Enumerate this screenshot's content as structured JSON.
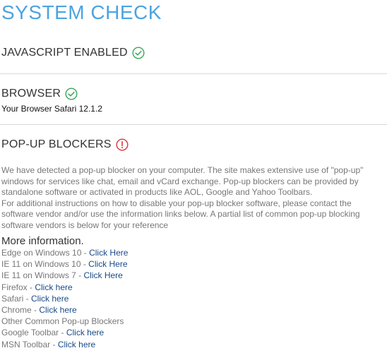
{
  "page": {
    "title": "SYSTEM CHECK"
  },
  "sections": {
    "javascript": {
      "label": "JAVASCRIPT ENABLED",
      "status": "ok"
    },
    "browser": {
      "label": "BROWSER",
      "status": "ok",
      "detail": "Your Browser Safari 12.1.2"
    },
    "popup": {
      "label": "POP-UP BLOCKERS",
      "status": "warning",
      "paragraph1": "We have detected a pop-up blocker on your computer. The site makes extensive use of \"pop-up\" windows for services like chat, email and vCard exchange. Pop-up blockers can be provided by standalone software or activated in products like AOL, Google and Yahoo Toolbars.",
      "paragraph2": "For additional instructions on how to disable your pop-up blocker software, please contact the software vendor and/or use the information links below. A partial list of common pop-up blocking software vendors is below for your reference"
    }
  },
  "more_info": {
    "heading": "More information.",
    "items": [
      {
        "label": "Edge on Windows 10 - ",
        "link": "Click Here"
      },
      {
        "label": "IE 11 on Windows 10 - ",
        "link": "Click Here"
      },
      {
        "label": "IE 11 on Windows 7 - ",
        "link": "Click Here"
      },
      {
        "label": "Firefox - ",
        "link": "Click here"
      },
      {
        "label": "Safari - ",
        "link": "Click here"
      },
      {
        "label": "Chrome - ",
        "link": "Click here"
      },
      {
        "label": "Other Common Pop-up Blockers",
        "link": ""
      },
      {
        "label": "Google Toolbar - ",
        "link": "Click here"
      },
      {
        "label": "MSN Toolbar - ",
        "link": "Click here"
      }
    ]
  },
  "colors": {
    "title": "#4da3e0",
    "ok": "#3aa757",
    "warning": "#d9363e",
    "link": "#1a4a8a"
  },
  "icons": {
    "ok": "check-circle-icon",
    "warning": "exclamation-circle-icon"
  }
}
